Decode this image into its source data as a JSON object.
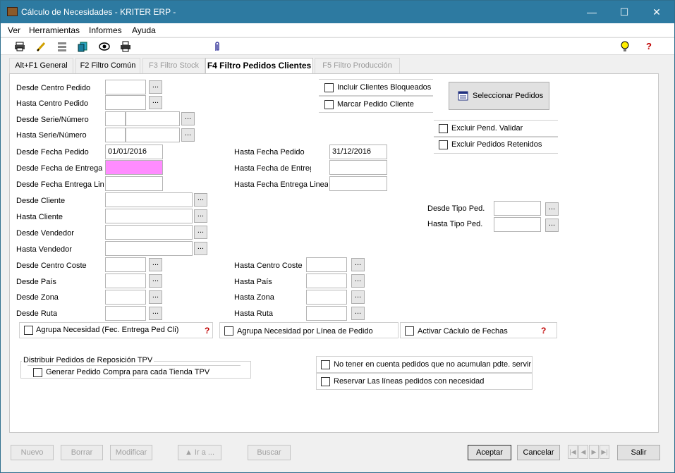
{
  "window": {
    "title": "Cálculo de Necesidades - KRITER ERP -",
    "controls": [
      "—",
      "☐",
      "✕"
    ]
  },
  "menu": [
    "Ver",
    "Herramientas",
    "Informes",
    "Ayuda"
  ],
  "toolbar": {
    "icons": [
      "printer-icon",
      "pencil-icon",
      "list-icon",
      "copy-icon",
      "eye-icon",
      "print-preview-icon",
      "paperclip-icon",
      "lightbulb-icon",
      "help-icon"
    ]
  },
  "tabs": [
    {
      "label": "Alt+F1 General",
      "state": "normal"
    },
    {
      "label": "F2 Filtro Común",
      "state": "normal"
    },
    {
      "label": "F3 Filtro Stock",
      "state": "disabled"
    },
    {
      "label": "F4 Filtro Pedidos Clientes",
      "state": "active"
    },
    {
      "label": "F5 Filtro Producción",
      "state": "disabled"
    }
  ],
  "fields": {
    "desde_centro_pedido": "Desde Centro Pedido",
    "hasta_centro_pedido": "Hasta Centro Pedido",
    "desde_serie_numero": "Desde Serie/Número",
    "hasta_serie_numero": "Hasta Serie/Número",
    "desde_fecha_pedido": "Desde Fecha Pedido",
    "desde_fecha_pedido_value": "01/01/2016",
    "hasta_fecha_pedido": "Hasta Fecha Pedido",
    "hasta_fecha_pedido_value": "31/12/2016",
    "desde_fecha_entrega": "Desde Fecha de Entrega",
    "hasta_fecha_entrega": "Hasta Fecha de Entrega",
    "desde_fecha_entrega_linea": "Desde Fecha Entrega Linea",
    "hasta_fecha_entrega_linea": "Hasta Fecha Entrega Linea",
    "desde_cliente": "Desde Cliente",
    "hasta_cliente": "Hasta Cliente",
    "desde_vendedor": "Desde Vendedor",
    "hasta_vendedor": "Hasta Vendedor",
    "desde_centro_coste": "Desde Centro Coste",
    "hasta_centro_coste": "Hasta Centro Coste",
    "desde_pais": "Desde País",
    "hasta_pais": "Hasta País",
    "desde_zona": "Desde Zona",
    "hasta_zona": "Hasta Zona",
    "desde_ruta": "Desde Ruta",
    "hasta_ruta": "Hasta Ruta",
    "desde_tipo_ped": "Desde Tipo Ped.",
    "hasta_tipo_ped": "Hasta Tipo Ped.",
    "ellipsis": "..."
  },
  "checkboxes": {
    "incluir_bloqueados": "Incluir Clientes Bloqueados",
    "marcar_pedido": "Marcar Pedido Cliente",
    "excluir_pend_validar": "Excluir  Pend. Validar",
    "excluir_retenidos": "Excluir Pedidos Retenidos",
    "agrupa_fec_entrega": "Agrupa Necesidad (Fec. Entrega Ped Cli)",
    "agrupa_linea": "Agrupa Necesidad por Línea de Pedido",
    "activar_calculo": "Activar Cáclulo de Fechas",
    "generar_pedido_compra": "Generar Pedido Compra para cada Tienda TPV",
    "no_tener_en_cuenta": "No tener en cuenta pedidos que no acumulan pdte. servir",
    "reservar_lineas": "Reservar Las líneas pedidos con necesidad"
  },
  "group_tpv_title": "Distribuir Pedidos de Reposición TPV",
  "seleccionar_pedidos": "Seleccionar Pedidos",
  "help_glyph": "?",
  "bottom": {
    "nuevo": "Nuevo",
    "borrar": "Borrar",
    "modificar": "Modificar",
    "ir_a": "▲  Ir a ...",
    "buscar": "Buscar",
    "aceptar": "Aceptar",
    "cancelar": "Cancelar",
    "salir": "Salir"
  },
  "colors": {
    "titlebar": "#2d7aa1",
    "pink_field": "#ff8cff"
  }
}
